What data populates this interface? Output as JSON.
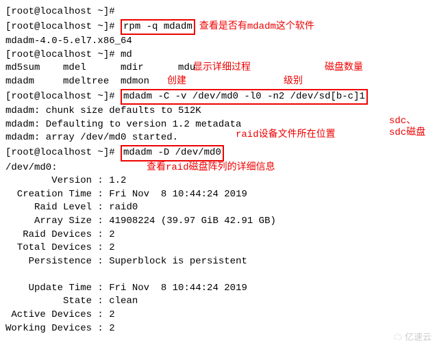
{
  "lines": {
    "l1": "[root@localhost ~]#",
    "l2_prompt": "[root@localhost ~]# ",
    "l2_cmd": "rpm -q mdadm",
    "l3": "mdadm-4.0-5.el7.x86_64",
    "l4": "[root@localhost ~]# md",
    "l5": "md5sum    mdel      mdir      mdu",
    "l6": "mdadm     mdeltree  mdmon",
    "l7_prompt": "[root@localhost ~]# ",
    "l7_cmd": "mdadm -C -v /dev/md0 -l0 -n2 /dev/sd[b-c]1",
    "l8": "mdadm: chunk size defaults to 512K",
    "l9": "mdadm: Defaulting to version 1.2 metadata",
    "l10": "mdadm: array /dev/md0 started.",
    "l11_prompt": "[root@localhost ~]# ",
    "l11_cmd": "mdadm -D /dev/md0",
    "l12": "/dev/md0:",
    "d_version_l": "        Version : ",
    "d_version_v": "1.2",
    "d_ctime_l": "  Creation Time : ",
    "d_ctime_v": "Fri Nov  8 10:44:24 2019",
    "d_rlevel_l": "     Raid Level : ",
    "d_rlevel_v": "raid0",
    "d_asize_l": "     Array Size : ",
    "d_asize_v": "41908224 (39.97 GiB 42.91 GB)",
    "d_rdev_l": "   Raid Devices : ",
    "d_rdev_v": "2",
    "d_tdev_l": "  Total Devices : ",
    "d_tdev_v": "2",
    "d_pers_l": "    Persistence : ",
    "d_pers_v": "Superblock is persistent",
    "d_utime_l": "    Update Time : ",
    "d_utime_v": "Fri Nov  8 10:44:24 2019",
    "d_state_l": "          State : ",
    "d_state_v": "clean",
    "d_adev_l": " Active Devices : ",
    "d_adev_v": "2",
    "d_wdev_l": "Working Devices : ",
    "d_wdev_v": "2"
  },
  "anno": {
    "a1": "查看是否有mdadm这个软件",
    "a2": "创建",
    "a3": "显示详细过程",
    "a4": "级别",
    "a5": "磁盘数量",
    "a6": "sdc、sdc磁盘",
    "a7": "raid设备文件所在位置",
    "a8": "查看raid磁盘阵列的详细信息"
  },
  "watermark": "亿速云"
}
